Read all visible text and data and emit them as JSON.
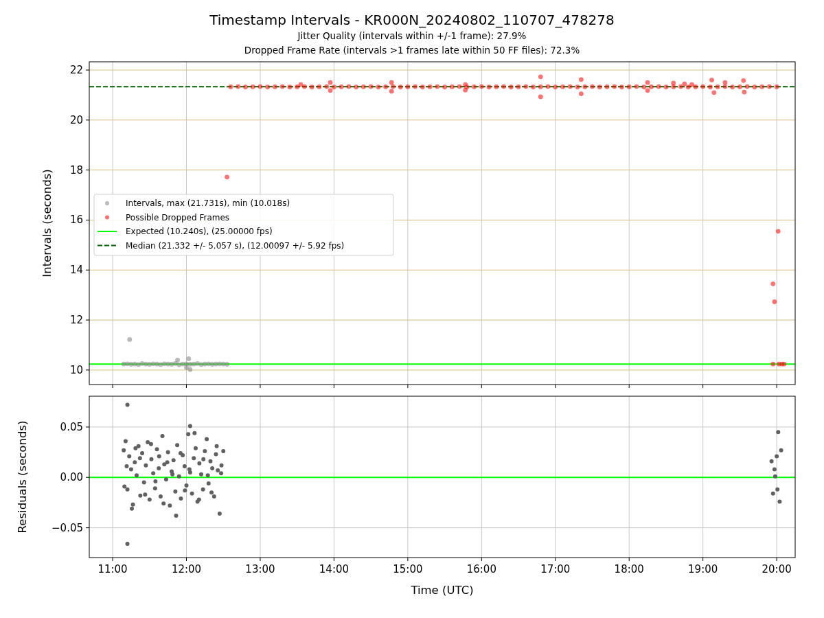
{
  "title": "Timestamp Intervals - KR000N_20240802_110707_478278",
  "subtitles": [
    "Jitter Quality (intervals within +/-1 frame): 27.9%",
    "Dropped Frame Rate (intervals >1 frames late within 50 FF files): 72.3%"
  ],
  "intervals_plot": {
    "chart_data": {
      "type": "scatter",
      "ylabel": "Intervals (seconds)",
      "xlim": [
        10.683,
        20.25
      ],
      "ylim": [
        9.42,
        22.33
      ],
      "grid": true,
      "yticks": [
        {
          "value": 10,
          "label": "10"
        },
        {
          "value": 12,
          "label": "12"
        },
        {
          "value": 14,
          "label": "14"
        },
        {
          "value": 16,
          "label": "16"
        },
        {
          "value": 18,
          "label": "18"
        },
        {
          "value": 20,
          "label": "20"
        },
        {
          "value": 22,
          "label": "22"
        }
      ],
      "series": [
        {
          "name": "Intervals, max (21.731s), min (10.018s)",
          "color": "#808080",
          "x": [
            11.15,
            11.2,
            11.25,
            11.3,
            11.35,
            11.4,
            11.45,
            11.5,
            11.55,
            11.6,
            11.65,
            11.7,
            11.75,
            11.8,
            11.85,
            11.9,
            11.95,
            12.0,
            12.05,
            12.1,
            12.15,
            12.2,
            12.25,
            12.3,
            12.35,
            12.4,
            12.45,
            12.5,
            12.55,
            11.23,
            12.05,
            11.88,
            12.03,
            12.0
          ],
          "values": [
            10.24,
            10.25,
            10.23,
            10.24,
            10.22,
            10.26,
            10.24,
            10.23,
            10.25,
            10.24,
            10.22,
            10.25,
            10.24,
            10.23,
            10.26,
            10.21,
            10.24,
            10.25,
            10.23,
            10.24,
            10.26,
            10.22,
            10.24,
            10.25,
            10.23,
            10.24,
            10.25,
            10.24,
            10.23,
            11.22,
            10.02,
            10.4,
            10.45,
            10.1
          ]
        },
        {
          "name": "Possible Dropped Frames",
          "color": "#ff0000",
          "x": [
            12.55,
            12.6,
            12.7,
            12.8,
            12.9,
            13.0,
            13.1,
            13.2,
            13.3,
            13.4,
            13.5,
            13.6,
            13.7,
            13.8,
            13.9,
            14.0,
            14.1,
            14.2,
            14.3,
            14.4,
            14.5,
            14.6,
            14.7,
            14.8,
            14.9,
            15.0,
            15.1,
            15.2,
            15.3,
            15.4,
            15.5,
            15.6,
            15.7,
            15.8,
            15.9,
            16.0,
            16.1,
            16.2,
            16.3,
            16.4,
            16.5,
            16.6,
            16.7,
            16.8,
            16.9,
            17.0,
            17.1,
            17.2,
            17.3,
            17.4,
            17.5,
            17.6,
            17.7,
            17.8,
            17.9,
            18.0,
            18.1,
            18.2,
            18.3,
            18.4,
            18.5,
            18.6,
            18.7,
            18.8,
            18.9,
            19.0,
            19.1,
            19.2,
            19.3,
            19.4,
            19.5,
            19.6,
            19.7,
            19.8,
            19.9,
            20.0,
            13.55,
            13.95,
            13.95,
            14.78,
            14.78,
            15.78,
            15.78,
            16.8,
            16.8,
            17.35,
            17.35,
            18.25,
            18.25,
            18.6,
            18.75,
            18.85,
            19.12,
            19.15,
            19.3,
            19.55,
            19.56,
            19.95,
            19.97,
            20.02,
            19.95,
            20.03,
            20.07,
            20.1
          ],
          "values": [
            17.72,
            21.33,
            21.34,
            21.32,
            21.33,
            21.34,
            21.32,
            21.33,
            21.34,
            21.32,
            21.33,
            21.34,
            21.32,
            21.33,
            21.34,
            21.32,
            21.33,
            21.34,
            21.32,
            21.33,
            21.34,
            21.32,
            21.33,
            21.34,
            21.32,
            21.33,
            21.34,
            21.32,
            21.33,
            21.34,
            21.32,
            21.33,
            21.34,
            21.32,
            21.33,
            21.34,
            21.32,
            21.33,
            21.34,
            21.32,
            21.33,
            21.34,
            21.32,
            21.33,
            21.34,
            21.32,
            21.33,
            21.34,
            21.32,
            21.33,
            21.34,
            21.32,
            21.33,
            21.34,
            21.32,
            21.33,
            21.34,
            21.32,
            21.33,
            21.34,
            21.32,
            21.33,
            21.34,
            21.32,
            21.33,
            21.34,
            21.32,
            21.33,
            21.34,
            21.32,
            21.33,
            21.34,
            21.32,
            21.33,
            21.34,
            21.33,
            21.42,
            21.5,
            21.18,
            21.5,
            21.15,
            21.42,
            21.2,
            21.73,
            20.93,
            21.62,
            21.05,
            21.5,
            21.18,
            21.48,
            21.45,
            21.42,
            21.6,
            21.1,
            21.5,
            21.58,
            21.12,
            13.45,
            12.73,
            15.55,
            10.24,
            10.24,
            10.24,
            10.24
          ]
        }
      ],
      "legend": true,
      "ref_lines": [
        {
          "axis": "y",
          "value": 10.24,
          "label": "Expected (10.240s), (25.00000 fps)",
          "color": "#00ff00"
        },
        {
          "axis": "y",
          "value": 21.332,
          "label": "Median (21.332 +/- 5.057 s), (12.00097 +/- 5.92 fps)",
          "color": "#006400"
        }
      ]
    }
  },
  "residuals_plot": {
    "chart_data": {
      "type": "scatter",
      "xlabel": "Time (UTC)",
      "ylabel": "Residuals (seconds)",
      "xlim": [
        10.683,
        20.25
      ],
      "ylim": [
        -0.0796,
        0.0806
      ],
      "grid": true,
      "xticks": [
        {
          "value": 11,
          "label": "11:00"
        },
        {
          "value": 12,
          "label": "12:00"
        },
        {
          "value": 13,
          "label": "13:00"
        },
        {
          "value": 14,
          "label": "14:00"
        },
        {
          "value": 15,
          "label": "15:00"
        },
        {
          "value": 16,
          "label": "16:00"
        },
        {
          "value": 17,
          "label": "17:00"
        },
        {
          "value": 18,
          "label": "18:00"
        },
        {
          "value": 19,
          "label": "19:00"
        },
        {
          "value": 20,
          "label": "20:00"
        }
      ],
      "yticks": [
        {
          "value": -0.05,
          "label": "−0.05"
        },
        {
          "value": 0,
          "label": "0.00"
        },
        {
          "value": 0.05,
          "label": "0.05"
        }
      ],
      "series": [
        {
          "color": "#606060",
          "x": [
            11.15,
            11.175,
            11.2,
            11.225,
            11.25,
            11.275,
            11.3,
            11.325,
            11.35,
            11.375,
            11.4,
            11.425,
            11.45,
            11.475,
            11.5,
            11.525,
            11.55,
            11.575,
            11.6,
            11.625,
            11.65,
            11.675,
            11.7,
            11.725,
            11.75,
            11.775,
            11.8,
            11.825,
            11.85,
            11.875,
            11.9,
            11.925,
            11.95,
            11.975,
            12.0,
            12.025,
            12.05,
            12.075,
            12.1,
            12.125,
            12.15,
            12.175,
            12.2,
            12.225,
            12.25,
            12.275,
            12.3,
            12.325,
            12.35,
            12.375,
            12.4,
            12.425,
            12.45,
            12.475,
            12.5,
            11.16,
            11.19,
            11.26,
            11.31,
            11.37,
            11.44,
            11.52,
            11.58,
            11.63,
            11.69,
            11.74,
            11.81,
            11.86,
            11.92,
            11.98,
            12.04,
            12.11,
            12.17,
            12.23,
            12.29,
            12.34,
            12.41,
            12.47,
            11.2,
            11.2,
            12.05,
            19.93,
            19.95,
            19.98,
            20.0,
            20.02,
            20.04,
            20.06,
            19.97,
            20.01
          ],
          "values": [
            0.027,
            0.036,
            -0.012,
            0.021,
            0.008,
            -0.027,
            0.015,
            0.002,
            0.031,
            -0.018,
            0.024,
            -0.005,
            0.012,
            0.035,
            -0.022,
            0.018,
            0.004,
            -0.011,
            0.028,
            0.009,
            -0.019,
            0.041,
            0.013,
            -0.002,
            0.025,
            -0.028,
            0.006,
            0.017,
            -0.014,
            0.032,
            0.001,
            -0.021,
            0.022,
            0.011,
            -0.008,
            0.043,
            0.005,
            -0.016,
            0.019,
            0.029,
            -0.024,
            0.014,
            0.003,
            -0.012,
            0.026,
            0.038,
            -0.006,
            0.016,
            0.009,
            -0.019,
            0.023,
            0.007,
            -0.036,
            0.012,
            0.026,
            -0.009,
            0.011,
            -0.031,
            0.029,
            0.019,
            -0.017,
            0.033,
            -0.004,
            0.021,
            -0.026,
            0.015,
            0.003,
            -0.038,
            0.024,
            -0.013,
            0.008,
            0.044,
            -0.022,
            0.018,
            0.002,
            -0.015,
            0.031,
            0.004,
            0.072,
            -0.066,
            0.051,
            0.016,
            -0.016,
            0.001,
            0.021,
            0.045,
            -0.024,
            0.027,
            0.008,
            -0.012
          ]
        }
      ],
      "ref_lines": [
        {
          "axis": "y",
          "value": 0,
          "color": "#00ff00"
        }
      ]
    }
  }
}
